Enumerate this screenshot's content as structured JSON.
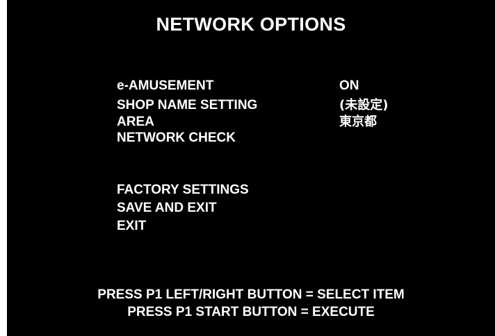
{
  "screen": {
    "title": "NETWORK OPTIONS",
    "items": [
      {
        "label": "e-AMUSEMENT",
        "value": "ON"
      },
      {
        "label": "SHOP NAME SETTING",
        "value": "(未設定)"
      },
      {
        "label": "AREA",
        "value": "東京都"
      },
      {
        "label": "NETWORK CHECK",
        "value": ""
      },
      {
        "label": "FACTORY SETTINGS",
        "value": ""
      },
      {
        "label": "SAVE AND EXIT",
        "value": ""
      },
      {
        "label": "EXIT",
        "value": ""
      }
    ],
    "footer": {
      "line1": "PRESS P1 LEFT/RIGHT BUTTON = SELECT ITEM",
      "line2": "PRESS P1 START BUTTON = EXECUTE"
    },
    "colors": {
      "background": "#000000",
      "text": "#ffffff"
    }
  }
}
